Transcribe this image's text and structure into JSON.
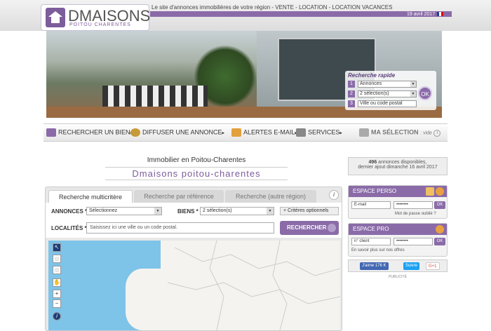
{
  "header": {
    "logo_main": "DMAISONS",
    "logo_sub": "POITOU CHARENTES",
    "tagline": "Le site d'annonces immobilières de votre région - VENTE - LOCATION - LOCATION VACANCES",
    "date": "19 avril 2017"
  },
  "quick_search": {
    "title": "Recherche rapide",
    "rows": [
      {
        "num": "1",
        "value": "Annonces"
      },
      {
        "num": "2",
        "value": "2 sélection(s)"
      },
      {
        "num": "3",
        "value": "Ville ou code postal"
      }
    ],
    "ok": "OK"
  },
  "nav": {
    "items": [
      {
        "label": "RECHERCHER UN BIEN"
      },
      {
        "label": "DIFFUSER UNE ANNONCE"
      },
      {
        "label": "ALERTES E-MAIL"
      },
      {
        "label": "SERVICES"
      },
      {
        "label": "MA SÉLECTION",
        "suffix": ": vide"
      }
    ]
  },
  "page": {
    "title": "Immobilier en Poitou-Charentes",
    "subtitle": "Dmaisons poitou-charentes"
  },
  "search": {
    "tabs": [
      "Recherche multicritère",
      "Recherche par référence",
      "Recherche (autre région)"
    ],
    "annonces_label": "ANNONCES *",
    "annonces_value": "Sélectionnez",
    "biens_label": "BIENS *",
    "biens_value": "2 sélection(s)",
    "criteres": "Critères optionnels",
    "localites_label": "LOCALITÉS *",
    "localites_placeholder": "Saisissez ici une ville ou un code postal.",
    "search_button": "RECHERCHER"
  },
  "stats": {
    "count": "496",
    "count_text": "annonces disponibles,",
    "last_added": "dernier ajout dimanche 16 avril 2017"
  },
  "espace_perso": {
    "title": "ESPACE PERSO",
    "email_placeholder": "E-mail",
    "password_placeholder": "••••••••",
    "ok": "OK",
    "forgot": "Mot de passe oublié ?"
  },
  "espace_pro": {
    "title": "ESPACE PRO",
    "client_placeholder": "n° client",
    "password_placeholder": "••••••••",
    "ok": "OK",
    "more": "En savoir plus sur nos offres"
  },
  "social": {
    "like": "J'aime 176 K",
    "follow": "Suivre",
    "gplus": "G+1"
  },
  "publicite": "PUBLICITÉ",
  "colors": {
    "accent": "#8a6ba8",
    "sea": "#7ec3e8"
  }
}
